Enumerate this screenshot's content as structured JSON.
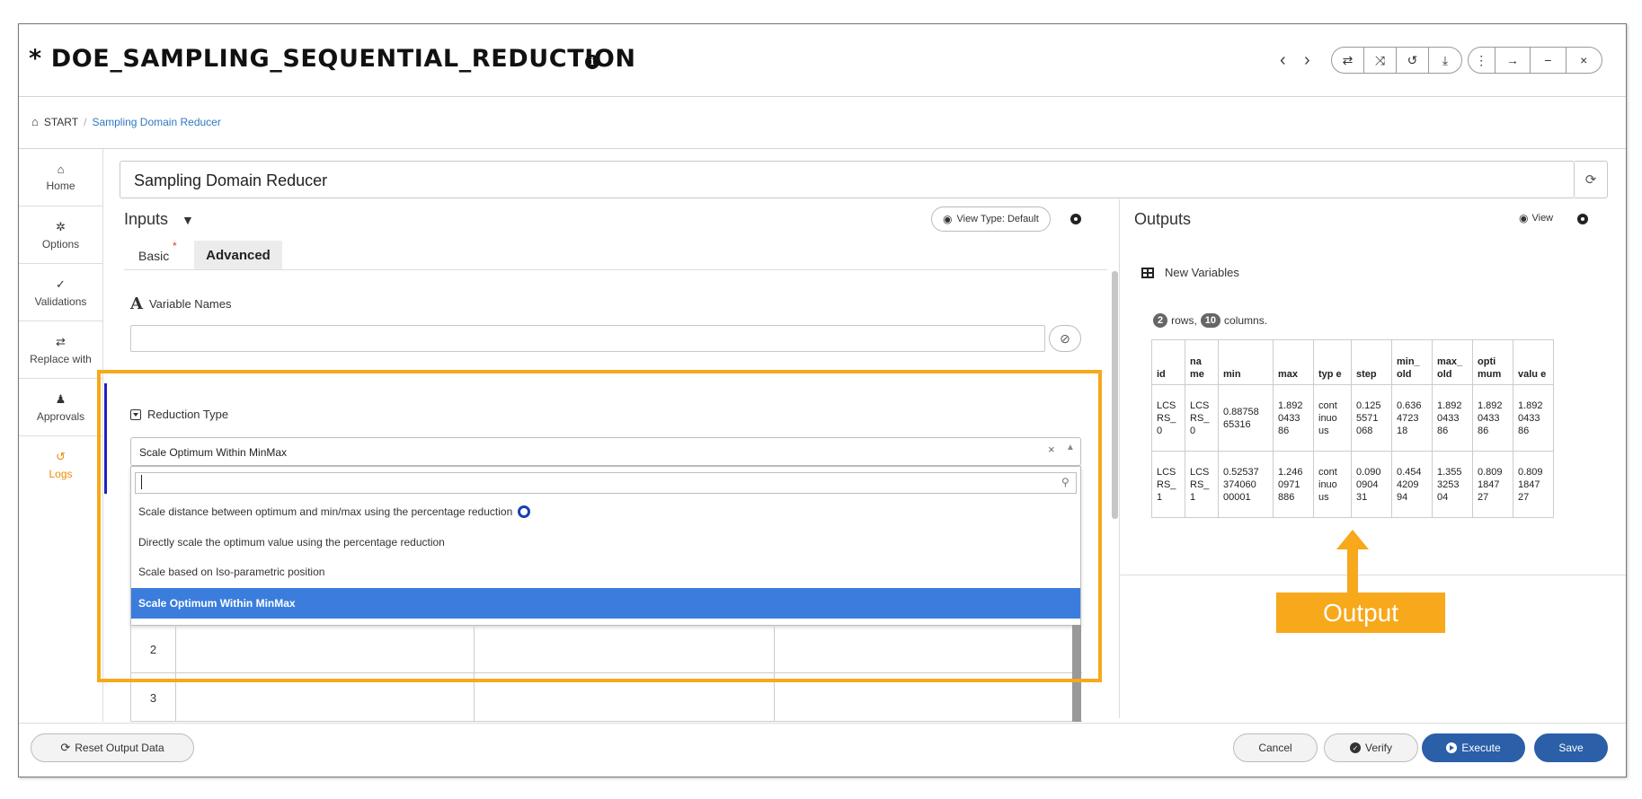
{
  "header": {
    "title": "* DOE_SAMPLING_SEQUENTIAL_REDUCTION",
    "nav_prev": "‹",
    "nav_next": "›",
    "toolbar_group1": [
      "⇄",
      "⤨",
      "↺",
      "⤓"
    ],
    "toolbar_group2": [
      "⋮",
      "→",
      "−",
      "×"
    ]
  },
  "breadcrumb": {
    "root": "START",
    "separator": "/",
    "current": "Sampling Domain Reducer"
  },
  "sidebar": {
    "items": [
      {
        "icon": "home-icon",
        "glyph": "⌂",
        "label": "Home"
      },
      {
        "icon": "gear-icon",
        "glyph": "✲",
        "label": "Options"
      },
      {
        "icon": "double-check-icon",
        "glyph": "✓",
        "label": "Validations"
      },
      {
        "icon": "swap-icon",
        "glyph": "⇄",
        "label": "Replace with"
      },
      {
        "icon": "user-check-icon",
        "glyph": "♟",
        "label": "Approvals"
      },
      {
        "icon": "history-icon",
        "glyph": "↺",
        "label": "Logs"
      }
    ],
    "active_item": "Logs",
    "active_color": "#f08c00"
  },
  "name_field": {
    "value": "Sampling Domain Reducer"
  },
  "inputs": {
    "title": "Inputs",
    "view_type_label": "View Type: Default",
    "tabs": [
      {
        "label": "Basic",
        "required_mark": "*"
      },
      {
        "label": "Advanced"
      }
    ],
    "variable_names_label": "Variable Names",
    "variable_names_value": "",
    "reduction_type": {
      "label": "Reduction Type",
      "selected": "Scale Optimum Within MinMax",
      "search_value": "",
      "options": [
        "Scale distance between optimum and min/max using the percentage reduction",
        "Directly scale the optimum value using the percentage reduction",
        "Scale based on Iso-parametric position",
        "Scale Optimum Within MinMax"
      ],
      "highlight_color": "#3b7ddd"
    },
    "grid_rows": [
      "2",
      "3"
    ]
  },
  "outputs": {
    "title": "Outputs",
    "view_label": "View",
    "new_variables_label": "New Variables",
    "rows_count": "2",
    "rows_text": "rows,",
    "cols_count": "10",
    "cols_text": "columns.",
    "table": {
      "headers": [
        "id",
        "na me",
        "min",
        "max",
        "typ e",
        "step",
        "min_ old",
        "max_ old",
        "opti mum",
        "valu e"
      ],
      "rows": [
        [
          "LCS RS_ 0",
          "LCS RS_ 0",
          "0.88758 65316",
          "1.892 0433 86",
          "cont inuo us",
          "0.125 5571 068",
          "0.636 4723 18",
          "1.892 0433 86",
          "1.892 0433 86",
          "1.892 0433 86"
        ],
        [
          "LCS RS_ 1",
          "LCS RS_ 1",
          "0.52537 374060 00001",
          "1.246 0971 886",
          "cont inuo us",
          "0.090 0904 31",
          "0.454 4209 94",
          "1.355 3253 04",
          "0.809 1847 27",
          "0.809 1847 27"
        ]
      ]
    },
    "callout_label": "Output",
    "callout_color": "#f7a81b"
  },
  "footer": {
    "reset_label": "Reset Output Data",
    "cancel_label": "Cancel",
    "verify_label": "Verify",
    "execute_label": "Execute",
    "save_label": "Save",
    "primary_color": "#2b5fa8"
  }
}
